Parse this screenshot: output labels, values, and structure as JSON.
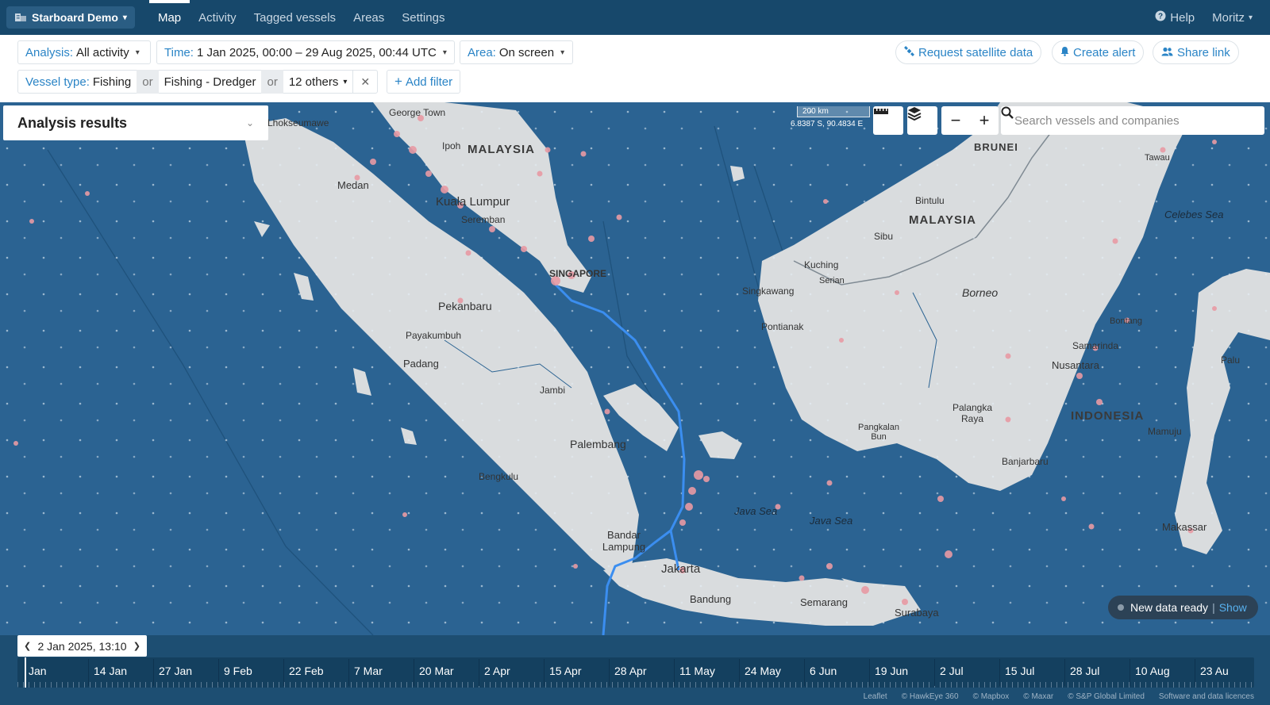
{
  "app": {
    "name": "Starboard Demo"
  },
  "nav": {
    "tabs": [
      {
        "label": "Map",
        "active": true
      },
      {
        "label": "Activity"
      },
      {
        "label": "Tagged vessels"
      },
      {
        "label": "Areas"
      },
      {
        "label": "Settings"
      }
    ],
    "help": "Help",
    "user": "Moritz"
  },
  "filters": {
    "analysis": {
      "key": "Analysis:",
      "value": "All activity"
    },
    "time": {
      "key": "Time:",
      "value": "1 Jan 2025, 00:00 – 29 Aug 2025, 00:44 UTC"
    },
    "area": {
      "key": "Area:",
      "value": "On screen"
    },
    "vessel_type": {
      "key": "Vessel type:",
      "values": [
        "Fishing",
        "Fishing - Dredger",
        "12 others"
      ],
      "joiner": "or"
    },
    "add_filter": "Add filter"
  },
  "actions": {
    "satellite": "Request satellite data",
    "alert": "Create alert",
    "share": "Share link"
  },
  "map": {
    "panel_title": "Analysis results",
    "scale": "200 km",
    "coords": "6.8387 S, 90.4834 E",
    "search_placeholder": "Search vessels and companies",
    "labels": {
      "malaysia_w": "MALAYSIA",
      "malaysia_e": "MALAYSIA",
      "indonesia": "INDONESIA",
      "brunei": "BRUNEI",
      "borneo": "Borneo",
      "celebes": "Celebes Sea",
      "java_sea_1": "Java Sea",
      "java_sea_2": "Java Sea",
      "george_town": "George Town",
      "ipoh": "Ipoh",
      "kl": "Kuala Lumpur",
      "seremban": "Seremban",
      "singapore": "SINGAPORE",
      "medan": "Medan",
      "lhokseumawe": "Lhokseumawe",
      "pekanbaru": "Pekanbaru",
      "payakumbuh": "Payakumbuh",
      "padang": "Padang",
      "jambi": "Jambi",
      "palembang": "Palembang",
      "bengkulu": "Bengkulu",
      "bandar_lampung": "Bandar Lampung",
      "jakarta": "Jakarta",
      "bandung": "Bandung",
      "semarang": "Semarang",
      "surabaya": "Surabaya",
      "kuching": "Kuching",
      "serian": "Serian",
      "sibu": "Sibu",
      "bintulu": "Bintulu",
      "singkawang": "Singkawang",
      "pontianak": "Pontianak",
      "palangka_raya": "Palangka Raya",
      "pangkalan_bun": "Pangkalan Bun",
      "banjarbaru": "Banjarbaru",
      "samarinda": "Samarinda",
      "bontang": "Bontang",
      "nusantara": "Nusantara",
      "mamuju": "Mamuju",
      "makassar": "Makassar",
      "palu": "Palu",
      "tawau": "Tawau"
    }
  },
  "new_data": {
    "text": "New data ready",
    "sep": "|",
    "link": "Show"
  },
  "timeline": {
    "cursor": "2 Jan 2025, 13:10",
    "labels": [
      "Jan",
      "14 Jan",
      "27 Jan",
      "9 Feb",
      "22 Feb",
      "7 Mar",
      "20 Mar",
      "2 Apr",
      "15 Apr",
      "28 Apr",
      "11 May",
      "24 May",
      "6 Jun",
      "19 Jun",
      "2 Jul",
      "15 Jul",
      "28 Jul",
      "10 Aug",
      "23 Au"
    ]
  },
  "attribution": [
    "Leaflet",
    "© HawkEye 360",
    "© Mapbox",
    "© Maxar",
    "© S&P Global Limited",
    "Software and data licences"
  ],
  "colors": {
    "navy": "#17486b",
    "accent": "#2a84c6",
    "sea": "#2b6392",
    "land": "#d9dcde",
    "track": "#3b8ef0",
    "point": "#e89aa4"
  }
}
